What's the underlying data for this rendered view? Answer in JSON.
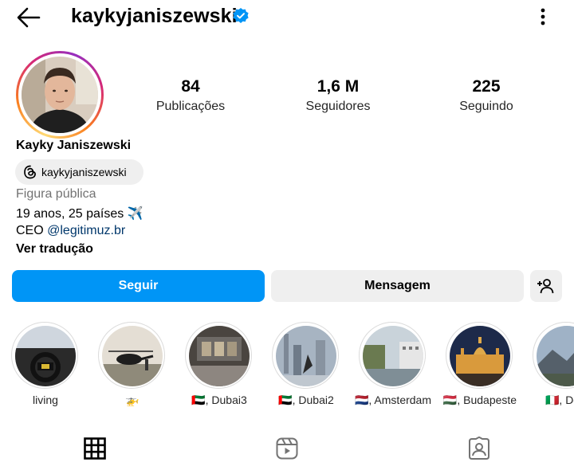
{
  "header": {
    "username": "kaykyjaniszewski",
    "back_icon": "arrow-left-icon",
    "verified_icon": "verified-badge-icon",
    "more_icon": "more-vertical-icon"
  },
  "stats": {
    "posts_count": "84",
    "posts_label": "Publicações",
    "followers_count": "1,6 M",
    "followers_label": "Seguidores",
    "following_count": "225",
    "following_label": "Seguindo"
  },
  "bio": {
    "full_name": "Kayky Janiszewski",
    "threads_handle": "kaykyjaniszewski",
    "category": "Figura pública",
    "line1": "19 anos, 25 países ✈️",
    "line2_prefix": "CEO ",
    "line2_link": "@legitimuz.br",
    "translate_label": "Ver tradução"
  },
  "actions": {
    "follow_label": "Seguir",
    "message_label": "Mensagem",
    "add_user_icon": "person-add-icon"
  },
  "highlights": [
    {
      "label": "living"
    },
    {
      "label": "🚁"
    },
    {
      "label": "🇦🇪, Dubai3"
    },
    {
      "label": "🇦🇪, Dubai2"
    },
    {
      "label": "🇳🇱, Amsterdam"
    },
    {
      "label": "🇭🇺, Budapeste"
    },
    {
      "label": "🇮🇹, Dolo"
    }
  ],
  "tabs": [
    {
      "icon": "grid-icon"
    },
    {
      "icon": "reels-icon"
    },
    {
      "icon": "tagged-icon"
    }
  ],
  "colors": {
    "accent": "#0095f6",
    "link": "#00376b",
    "secondary_button": "#efefef"
  }
}
